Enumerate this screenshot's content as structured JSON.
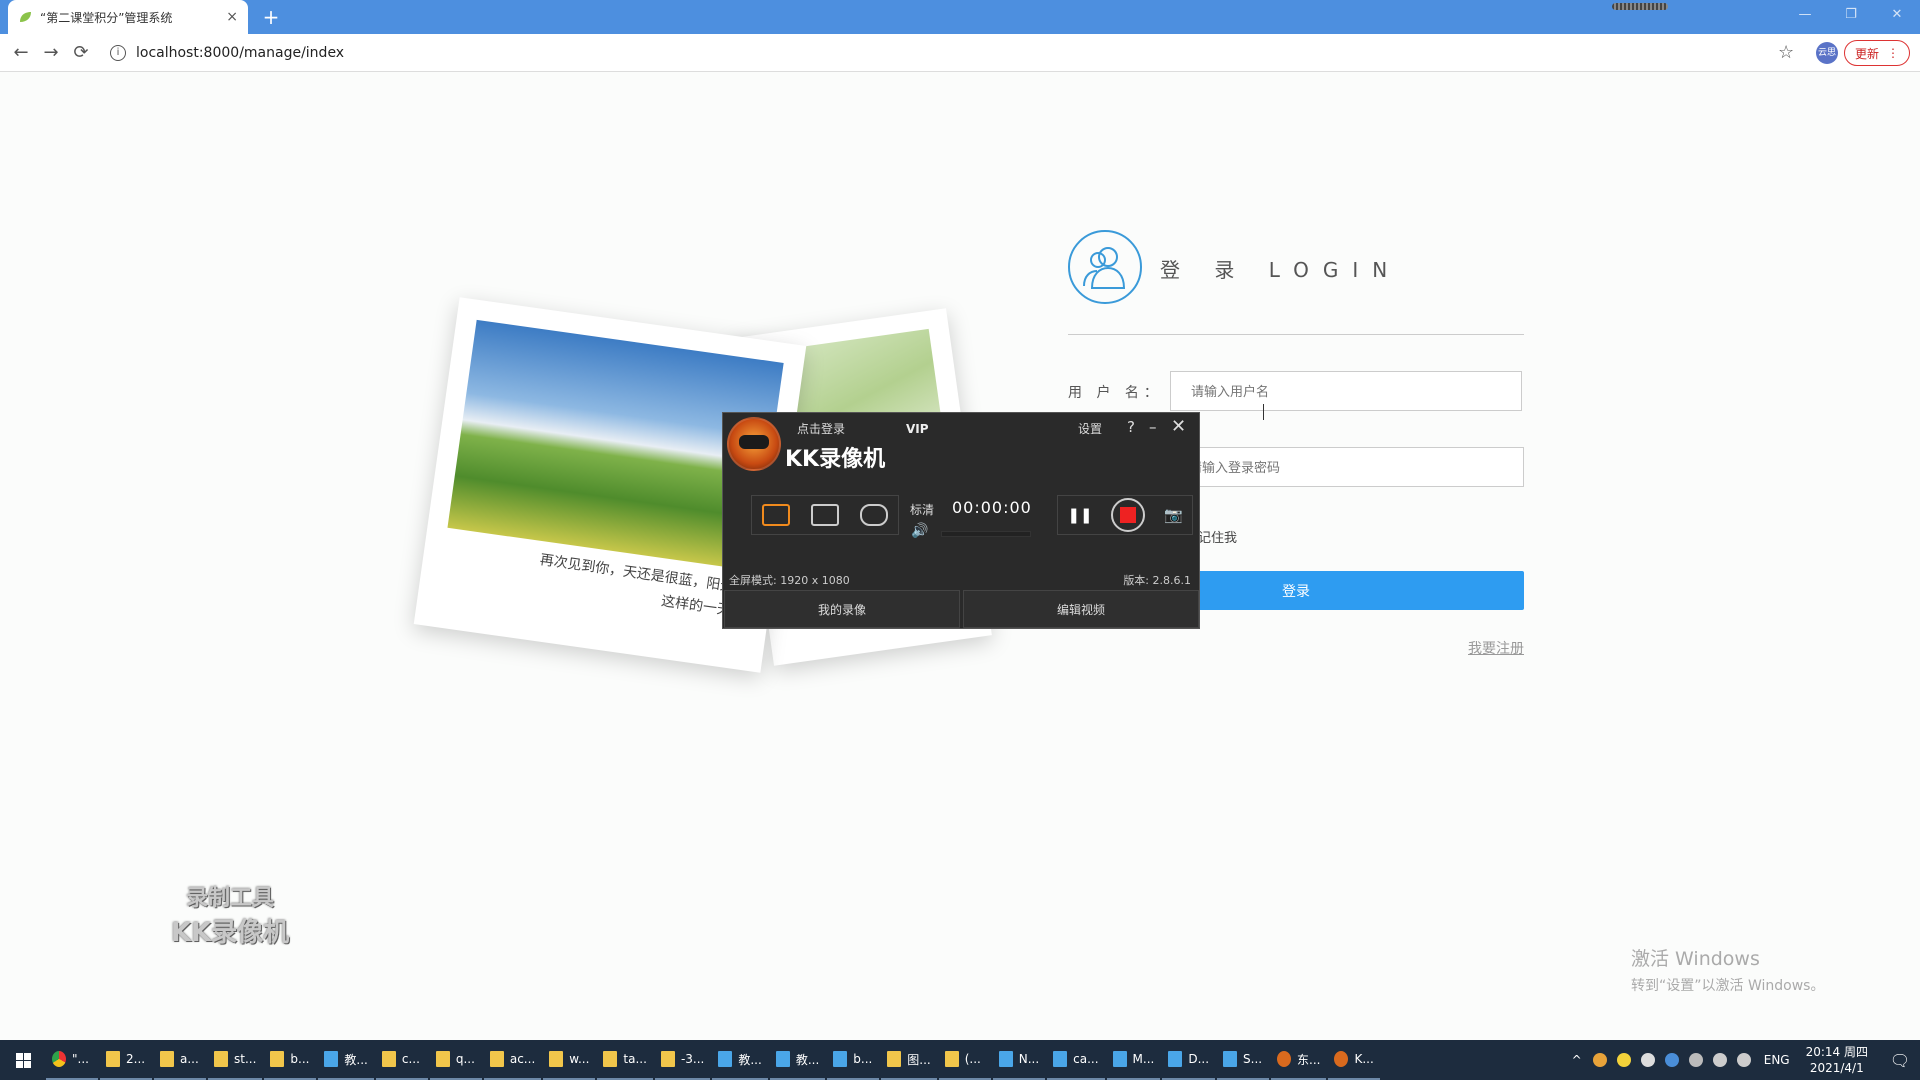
{
  "browser": {
    "tab_title": "“第二课堂积分”管理系统",
    "tab_close": "×",
    "new_tab": "+",
    "back": "←",
    "forward": "→",
    "reload": "⟳",
    "url": "localhost:8000/manage/index",
    "star": "☆",
    "profile_initials": "云思",
    "update_label": "更新",
    "update_menu": "⋮",
    "window_controls": {
      "minimize": "—",
      "restore": "❐",
      "close": "✕"
    }
  },
  "photos": {
    "caption_line1": "再次见到你，天还是很蓝，阳光明媚",
    "caption_line2": "这样的一天真好"
  },
  "login": {
    "title": "登 录 LOGIN",
    "username_label": "用 户 名：",
    "username_placeholder": "请输入用户名",
    "password_placeholder": "请输入登录密码",
    "remember_label": "记住我",
    "login_button": "登录",
    "register_link": "我要注册",
    "accent_color": "#2e9cf1"
  },
  "kk_recorder": {
    "login_link": "点击登录",
    "vip": "VIP",
    "brand": "KK录像机",
    "settings": "设置",
    "help": "?",
    "minimize": "–",
    "close": "✕",
    "quality": "标清",
    "timer": "00:00:00",
    "pause": "❚❚",
    "screenshot": "📷",
    "volume": "🔊",
    "mode_text": "全屏模式: 1920 x 1080",
    "version": "版本: 2.8.6.1",
    "my_recordings": "我的录像",
    "edit_video": "编辑视频"
  },
  "watermark": {
    "line1": "录制工具",
    "line2": "KK录像机"
  },
  "windows_activation": {
    "line1": "激活 Windows",
    "line2": "转到“设置”以激活 Windows。"
  },
  "taskbar": {
    "items": [
      {
        "label": "\"...",
        "kind": "chrome"
      },
      {
        "label": "2...",
        "kind": "folder"
      },
      {
        "label": "a...",
        "kind": "folder"
      },
      {
        "label": "st...",
        "kind": "folder"
      },
      {
        "label": "b...",
        "kind": "folder"
      },
      {
        "label": "教...",
        "kind": "blue"
      },
      {
        "label": "c...",
        "kind": "folder"
      },
      {
        "label": "q...",
        "kind": "folder"
      },
      {
        "label": "ac...",
        "kind": "folder"
      },
      {
        "label": "w...",
        "kind": "folder"
      },
      {
        "label": "ta...",
        "kind": "folder"
      },
      {
        "label": "-3...",
        "kind": "folder"
      },
      {
        "label": "教...",
        "kind": "blue"
      },
      {
        "label": "教...",
        "kind": "blue"
      },
      {
        "label": "b...",
        "kind": "blue"
      },
      {
        "label": "图...",
        "kind": "folder"
      },
      {
        "label": "(...",
        "kind": "folder"
      },
      {
        "label": "N...",
        "kind": "blue"
      },
      {
        "label": "ca...",
        "kind": "blue"
      },
      {
        "label": "M...",
        "kind": "blue"
      },
      {
        "label": "D...",
        "kind": "blue"
      },
      {
        "label": "S...",
        "kind": "blue"
      },
      {
        "label": "东...",
        "kind": "kk"
      },
      {
        "label": "K...",
        "kind": "kk"
      }
    ],
    "lang": "ENG",
    "time": "20:14 周四",
    "date": "2021/4/1",
    "tray_caret": "^",
    "notification": "🗨"
  }
}
